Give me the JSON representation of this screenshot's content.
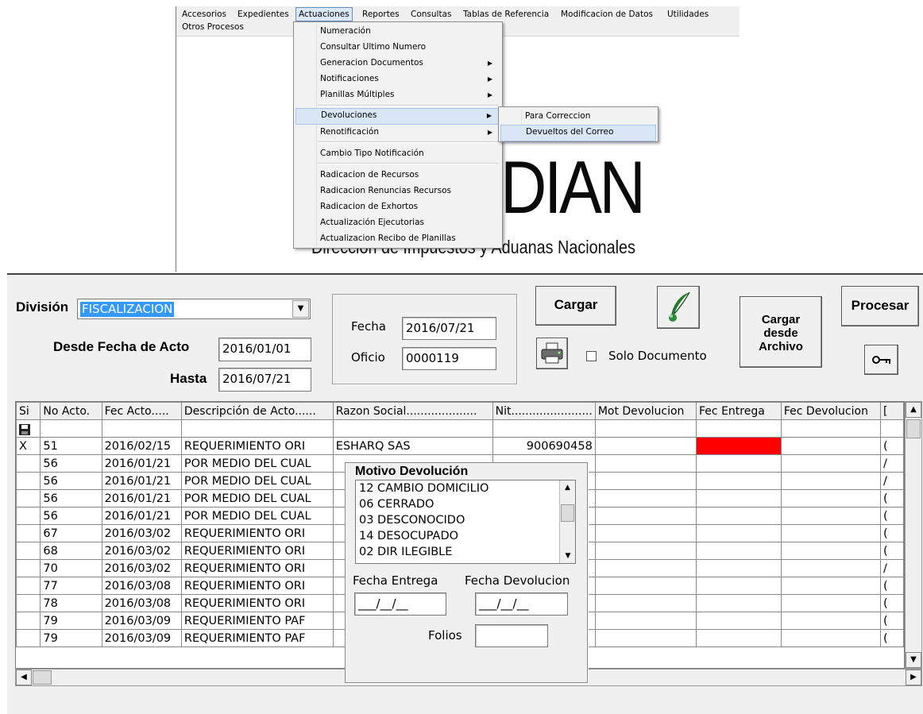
{
  "menubar": {
    "items": [
      "Accesorios",
      "Expedientes",
      "Actuaciones",
      "Reportes",
      "Consultas",
      "Tablas de Referencia",
      "Modificacion de Datos",
      "Utilidades"
    ],
    "second_row": "Otros Procesos"
  },
  "actuaciones_menu": {
    "items": [
      "Numeración",
      "Consultar Ultimo Numero",
      "Generacion Documentos",
      "Notificaciones",
      "Planillas Múltiples",
      "Devoluciones",
      "Renotificación",
      "Cambio Tipo Notificación",
      "Radicacion de Recursos",
      "Radicacion Renuncias Recursos",
      "Radicacion de Exhortos",
      "Actualización Ejecutorias",
      "Actualizacion Recibo de Planillas"
    ],
    "highlighted": "Devoluciones"
  },
  "devoluciones_submenu": {
    "items": [
      "Para Correccion",
      "Devueltos del Correo"
    ],
    "highlighted": "Devueltos del Correo"
  },
  "brand": {
    "logo_text": "DIAN",
    "subtitle": "Dirección de Impuestos y Aduanas Nacionales"
  },
  "form": {
    "division_label": "División",
    "division_value": "FISCALIZACION",
    "desde_label": "Desde Fecha de Acto",
    "desde_value": "2016/01/01",
    "hasta_label": "Hasta",
    "hasta_value": "2016/07/21",
    "fecha_label": "Fecha",
    "fecha_value": "2016/07/21",
    "oficio_label": "Oficio",
    "oficio_value": "0000119",
    "cargar_label": "Cargar",
    "solo_documento_label": "Solo Documento",
    "cargar_archivo_label": "Cargar desde Archivo",
    "procesar_label": "Procesar"
  },
  "grid": {
    "headers": [
      "Si",
      "No Acto.",
      "Fec Acto.....",
      "Descripción de Acto......",
      "Razon Social....................",
      "Nit.......................",
      "Mot Devolucion",
      "Fec Entrega",
      "Fec Devolucion",
      "["
    ],
    "rows": [
      {
        "si": "",
        "no": "",
        "fec": "",
        "desc": "",
        "razon": "",
        "nit": "",
        "last": ""
      },
      {
        "si": "X",
        "no": "51",
        "fec": "2016/02/15",
        "desc": "REQUERIMIENTO ORI",
        "razon": "ESHARQ SAS",
        "nit": "900690458",
        "last": "("
      },
      {
        "si": "",
        "no": "56",
        "fec": "2016/01/21",
        "desc": "POR MEDIO DEL CUAL",
        "razon": "",
        "nit": "",
        "last": "/"
      },
      {
        "si": "",
        "no": "56",
        "fec": "2016/01/21",
        "desc": "POR MEDIO DEL CUAL",
        "razon": "",
        "nit": "",
        "last": "/"
      },
      {
        "si": "",
        "no": "56",
        "fec": "2016/01/21",
        "desc": "POR MEDIO DEL CUAL",
        "razon": "",
        "nit": "",
        "last": "("
      },
      {
        "si": "",
        "no": "56",
        "fec": "2016/01/21",
        "desc": "POR MEDIO DEL CUAL",
        "razon": "",
        "nit": "",
        "last": "("
      },
      {
        "si": "",
        "no": "67",
        "fec": "2016/03/02",
        "desc": "REQUERIMIENTO ORI",
        "razon": "",
        "nit": "",
        "last": "("
      },
      {
        "si": "",
        "no": "68",
        "fec": "2016/03/02",
        "desc": "REQUERIMIENTO ORI",
        "razon": "",
        "nit": "",
        "last": "("
      },
      {
        "si": "",
        "no": "70",
        "fec": "2016/03/02",
        "desc": "REQUERIMIENTO ORI",
        "razon": "",
        "nit": "",
        "last": "/"
      },
      {
        "si": "",
        "no": "77",
        "fec": "2016/03/08",
        "desc": "REQUERIMIENTO ORI",
        "razon": "",
        "nit": "",
        "last": "("
      },
      {
        "si": "",
        "no": "78",
        "fec": "2016/03/08",
        "desc": "REQUERIMIENTO ORI",
        "razon": "",
        "nit": "",
        "last": "("
      },
      {
        "si": "",
        "no": "79",
        "fec": "2016/03/09",
        "desc": "REQUERIMIENTO PAF",
        "razon": "",
        "nit": "",
        "last": "("
      },
      {
        "si": "",
        "no": "79",
        "fec": "2016/03/09",
        "desc": "REQUERIMIENTO PAF",
        "razon": "",
        "nit": "",
        "last": "("
      }
    ],
    "highlight_color": "#ff0000"
  },
  "popup": {
    "title": "Motivo Devolución",
    "options": [
      "12 CAMBIO DOMICILIO",
      "06 CERRADO",
      "03 DESCONOCIDO",
      "14 DESOCUPADO",
      "02 DIR ILEGIBLE"
    ],
    "fecha_entrega_label": "Fecha Entrega",
    "fecha_entrega_value": "___/__/__",
    "fecha_devolucion_label": "Fecha Devolucion",
    "fecha_devolucion_value": "___/__/__",
    "folios_label": "Folios",
    "folios_value": ""
  },
  "icons": {
    "save_row": "floppy-disk-icon",
    "print": "printer-icon",
    "feather": "quill-icon",
    "key": "key-icon"
  }
}
